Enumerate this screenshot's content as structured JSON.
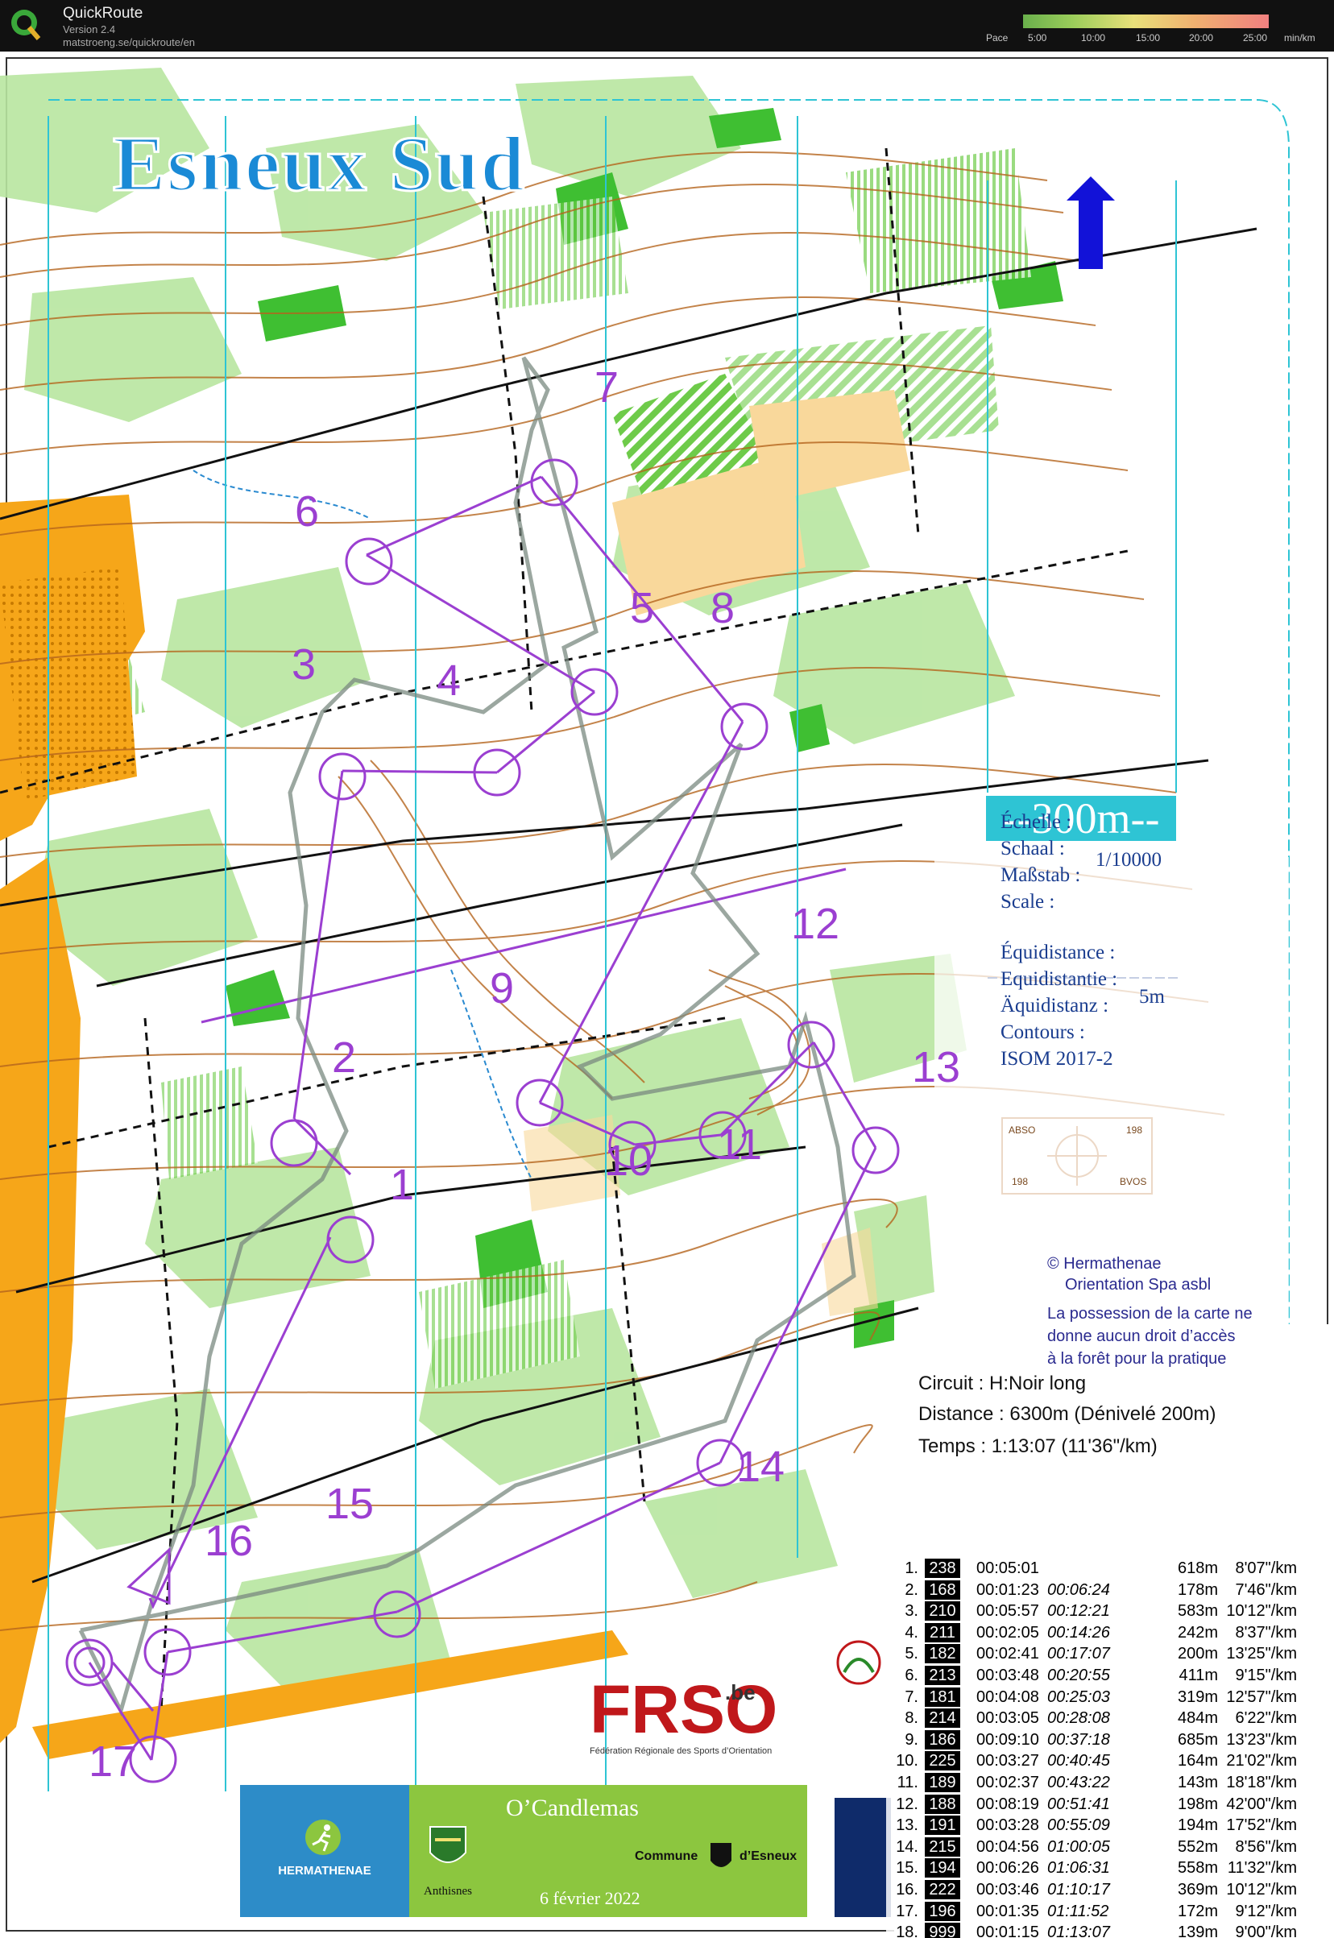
{
  "app": {
    "name": "QuickRoute",
    "version": "Version 2.4",
    "url": "matstroeng.se/quickroute/en",
    "pace_label": "Pace",
    "pace_ticks": [
      "5:00",
      "10:00",
      "15:00",
      "20:00",
      "25:00"
    ],
    "pace_unit": "min/km"
  },
  "map": {
    "title": "Esneux Sud",
    "scale_bar": "--300m--",
    "legend": {
      "scale_labels": [
        "Échelle  :",
        "Schaal    :",
        "Maßstab :",
        "Scale      :"
      ],
      "scale_value": "1/10000",
      "equidistance_labels": [
        "Équidistance :",
        "Equidistantie :",
        "Äquidistanz    :",
        "Contours        :",
        "ISOM 2017-2"
      ],
      "equidistance_value": "5m"
    },
    "compass_box": {
      "tl": "ABSO",
      "tr": "198",
      "bl": "198",
      "br": "BVOS"
    },
    "copyright": [
      "© Hermathenae",
      "Orientation Spa asbl"
    ],
    "notice": [
      "La possession de la carte ne",
      "donne aucun droit d’accès",
      "à la forêt pour la pratique"
    ],
    "control_numbers": [
      "1",
      "2",
      "3",
      "4",
      "5",
      "6",
      "7",
      "8",
      "9",
      "10",
      "11",
      "12",
      "13",
      "14",
      "15",
      "16",
      "17"
    ]
  },
  "course": {
    "circuit": "Circuit : H:Noir long",
    "distance": "Distance : 6300m (Dénivelé 200m)",
    "time": "Temps : 1:13:07 (11'36\"/km)"
  },
  "splits": [
    {
      "idx": "1.",
      "code": "238",
      "time": "00:05:01",
      "cum": "",
      "dist": "618m",
      "pace": "8'07\"/km"
    },
    {
      "idx": "2.",
      "code": "168",
      "time": "00:01:23",
      "cum": "00:06:24",
      "dist": "178m",
      "pace": "7'46\"/km"
    },
    {
      "idx": "3.",
      "code": "210",
      "time": "00:05:57",
      "cum": "00:12:21",
      "dist": "583m",
      "pace": "10'12\"/km"
    },
    {
      "idx": "4.",
      "code": "211",
      "time": "00:02:05",
      "cum": "00:14:26",
      "dist": "242m",
      "pace": "8'37\"/km"
    },
    {
      "idx": "5.",
      "code": "182",
      "time": "00:02:41",
      "cum": "00:17:07",
      "dist": "200m",
      "pace": "13'25\"/km"
    },
    {
      "idx": "6.",
      "code": "213",
      "time": "00:03:48",
      "cum": "00:20:55",
      "dist": "411m",
      "pace": "9'15\"/km"
    },
    {
      "idx": "7.",
      "code": "181",
      "time": "00:04:08",
      "cum": "00:25:03",
      "dist": "319m",
      "pace": "12'57\"/km"
    },
    {
      "idx": "8.",
      "code": "214",
      "time": "00:03:05",
      "cum": "00:28:08",
      "dist": "484m",
      "pace": "6'22\"/km"
    },
    {
      "idx": "9.",
      "code": "186",
      "time": "00:09:10",
      "cum": "00:37:18",
      "dist": "685m",
      "pace": "13'23\"/km"
    },
    {
      "idx": "10.",
      "code": "225",
      "time": "00:03:27",
      "cum": "00:40:45",
      "dist": "164m",
      "pace": "21'02\"/km"
    },
    {
      "idx": "11.",
      "code": "189",
      "time": "00:02:37",
      "cum": "00:43:22",
      "dist": "143m",
      "pace": "18'18\"/km"
    },
    {
      "idx": "12.",
      "code": "188",
      "time": "00:08:19",
      "cum": "00:51:41",
      "dist": "198m",
      "pace": "42'00\"/km"
    },
    {
      "idx": "13.",
      "code": "191",
      "time": "00:03:28",
      "cum": "00:55:09",
      "dist": "194m",
      "pace": "17'52\"/km"
    },
    {
      "idx": "14.",
      "code": "215",
      "time": "00:04:56",
      "cum": "01:00:05",
      "dist": "552m",
      "pace": "8'56\"/km"
    },
    {
      "idx": "15.",
      "code": "194",
      "time": "00:06:26",
      "cum": "01:06:31",
      "dist": "558m",
      "pace": "11'32\"/km"
    },
    {
      "idx": "16.",
      "code": "222",
      "time": "00:03:46",
      "cum": "01:10:17",
      "dist": "369m",
      "pace": "10'12\"/km"
    },
    {
      "idx": "17.",
      "code": "196",
      "time": "00:01:35",
      "cum": "01:11:52",
      "dist": "172m",
      "pace": "9'12\"/km"
    },
    {
      "idx": "18.",
      "code": "999",
      "time": "00:01:15",
      "cum": "01:13:07",
      "dist": "139m",
      "pace": "9'00\"/km"
    }
  ],
  "sponsors": {
    "fr_logo": "FRSO",
    "fr_suffix": ".be",
    "fr_caption": "Fédération Régionale des Sports d’Orientation",
    "hermathenae": "HERMATHENAE",
    "event": "O’Candlemas",
    "commune": "Commune",
    "esneux": "d’Esneux",
    "anthisnes": "Anthisnes",
    "date": "6 février 2022"
  },
  "colors": {
    "course": "#9b3fd1",
    "route": "#7a8a80",
    "water": "#2ec4d4",
    "title": "#1a8ad6"
  }
}
